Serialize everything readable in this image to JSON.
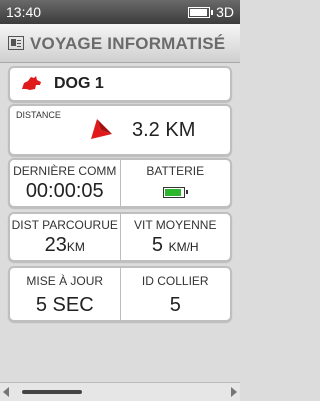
{
  "status": {
    "time": "13:40",
    "mode": "3D",
    "battery_level": 0.85
  },
  "header": {
    "title": "VOYAGE INFORMATISÉ",
    "icon": "document-icon"
  },
  "dog": {
    "name": "DOG 1",
    "icon": "dog-icon",
    "color": "#e01a1a"
  },
  "distance": {
    "label": "DISTANCE",
    "value": "3.2 KM",
    "arrow_color": "#e01a1a"
  },
  "comm": {
    "label": "DERNIÈRE COMM",
    "value": "00:00:05"
  },
  "battery": {
    "label": "BATTERIE",
    "level": 0.9,
    "color": "#2db52d"
  },
  "dist_parcourue": {
    "label": "DIST PARCOURUE",
    "value": "23",
    "unit": "KM"
  },
  "vit_moyenne": {
    "label": "VIT MOYENNE",
    "value": "5 ",
    "unit": "KM/H"
  },
  "mise_a_jour": {
    "label": "MISE À JOUR",
    "value": "5 SEC"
  },
  "id_collier": {
    "label": "ID COLLIER",
    "value": "5"
  }
}
